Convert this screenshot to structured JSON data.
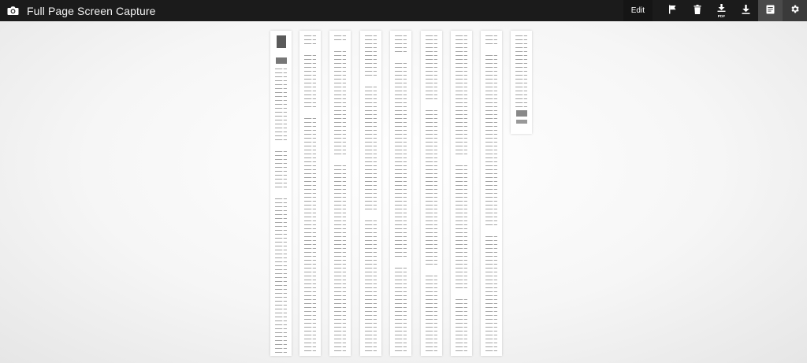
{
  "app": {
    "title": "Full Page Screen Capture"
  },
  "toolbar": {
    "edit_label": "Edit",
    "pdf_badge": "PDF",
    "buttons": [
      {
        "name": "flag",
        "icon": "flag-icon"
      },
      {
        "name": "delete",
        "icon": "trash-icon"
      },
      {
        "name": "download-pdf",
        "icon": "download-pdf-icon"
      },
      {
        "name": "download-image",
        "icon": "download-icon"
      },
      {
        "name": "document-view",
        "icon": "document-icon",
        "active": true
      },
      {
        "name": "settings",
        "icon": "gear-icon"
      }
    ]
  },
  "capture": {
    "strip_count": 9
  }
}
